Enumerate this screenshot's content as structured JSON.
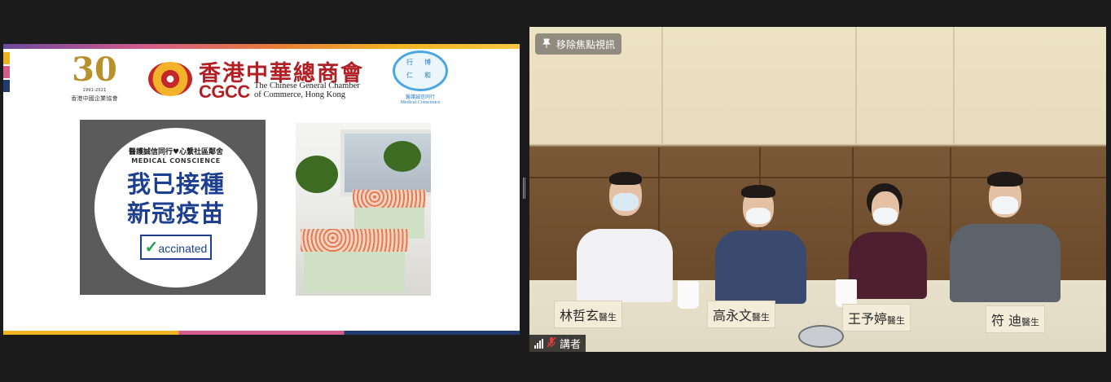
{
  "shared_screen": {
    "logo_30": {
      "number": "30",
      "years": "1991-2021",
      "caption": "香港中國企業協會"
    },
    "cgcc_logo": {
      "chinese": "香港中華總商會",
      "acronym": "CGCC",
      "english_line1": "The Chinese General Chamber",
      "english_line2": "of Commerce, Hong Kong"
    },
    "mc_logo": {
      "char1": "行",
      "char2": "博",
      "char3": "仁",
      "char4": "和",
      "chinese": "醫護誠信同行",
      "english": "Medical Conscience"
    },
    "badge": {
      "org": "醫護誠信同行♥心繫社區鄰舍",
      "org_en": "MEDICAL CONSCIENCE",
      "line1": "我已接種",
      "line2": "新冠疫苗",
      "vaccinated_check": "✓",
      "vaccinated_text": "accinated"
    }
  },
  "video": {
    "pin_button": "移除焦點視訊",
    "speaker_label": "講者",
    "nameplates": [
      {
        "name": "林哲玄",
        "title": "醫生"
      },
      {
        "name": "高永文",
        "title": "醫生"
      },
      {
        "name": "王予婷",
        "title": "醫生"
      },
      {
        "name": "符 迪",
        "title": "醫生"
      }
    ]
  },
  "colors": {
    "cgcc_red": "#b21f24",
    "badge_blue": "#1d3f8f",
    "check_green": "#22a050",
    "background": "#1b1b1b"
  }
}
